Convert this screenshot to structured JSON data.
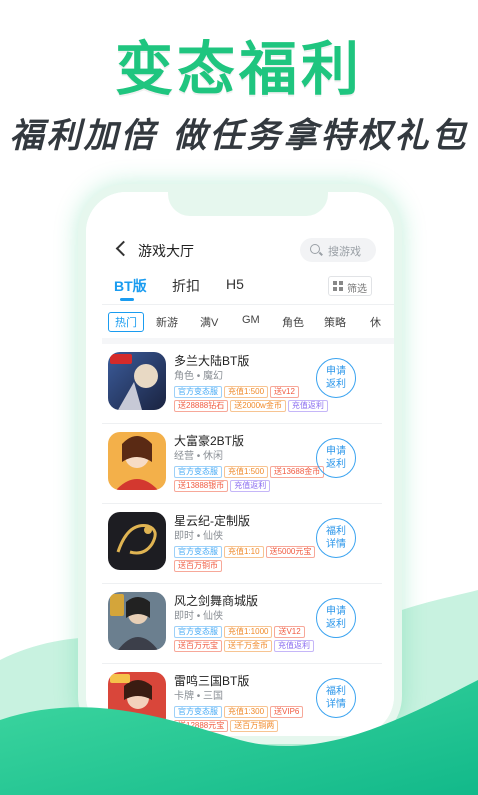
{
  "hero": {
    "headline": "变态福利",
    "subline": "福利加倍 做任务拿特权礼包"
  },
  "colors": {
    "brand_green": "#1fc57f",
    "accent_blue": "#1a9cf0",
    "wave_green": "#17c28c"
  },
  "phone": {
    "topbar": {
      "back_icon": "chevron-left-icon",
      "title": "游戏大厅",
      "search_placeholder": "搜游戏"
    },
    "tabs": [
      {
        "label": "BT版",
        "active": true
      },
      {
        "label": "折扣",
        "active": false
      },
      {
        "label": "H5",
        "active": false
      }
    ],
    "filter_label": "筛选",
    "categories": [
      "热门",
      "新游",
      "满V",
      "GM",
      "角色",
      "策略",
      "休"
    ],
    "games": [
      {
        "name": "多兰大陆BT版",
        "category": "角色 • 魔幻",
        "tags_row1": [
          "官方变态服",
          "充值1:500",
          "送v12"
        ],
        "tags_row2": [
          "送28888钻石",
          "送2000w金币",
          "充值返利"
        ],
        "button": [
          "申请",
          "返利"
        ]
      },
      {
        "name": "大富豪2BT版",
        "category": "经营 • 休闲",
        "tags_row1": [
          "官方变态服",
          "充值1:500",
          "送13688金币"
        ],
        "tags_row2": [
          "送13888银币",
          "充值返利"
        ],
        "button": [
          "申请",
          "返利"
        ]
      },
      {
        "name": "星云纪-定制版",
        "category": "即时 • 仙侠",
        "tags_row1": [
          "官方变态服",
          "充值1:10",
          "送5000元宝"
        ],
        "tags_row2": [
          "送百万铜币"
        ],
        "button": [
          "福利",
          "详情"
        ]
      },
      {
        "name": "风之剑舞商城版",
        "category": "即时 • 仙侠",
        "tags_row1": [
          "官方变态服",
          "充值1:1000",
          "送V12"
        ],
        "tags_row2": [
          "送百万元宝",
          "送千万金币",
          "充值返利"
        ],
        "button": [
          "申请",
          "返利"
        ]
      },
      {
        "name": "雷鸣三国BT版",
        "category": "卡牌 • 三国",
        "tags_row1": [
          "官方变态服",
          "充值1:300",
          "送VIP6"
        ],
        "tags_row2": [
          "送12888元宝",
          "送百万铜两"
        ],
        "button": [
          "福利",
          "详情"
        ]
      }
    ]
  }
}
